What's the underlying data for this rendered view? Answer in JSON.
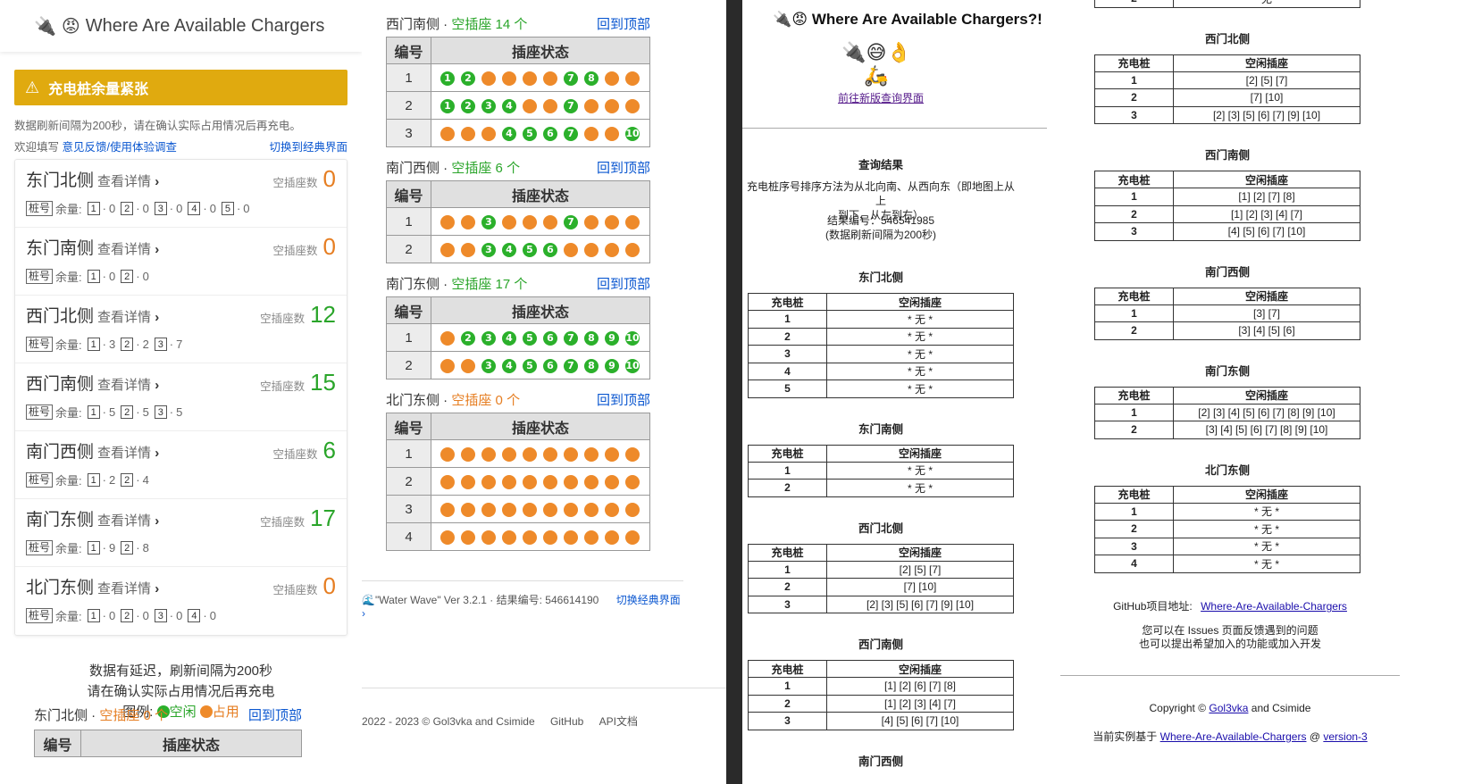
{
  "app": {
    "title": "Where Are Available Chargers",
    "warning": "充电桩余量紧张",
    "refresh_note": "数据刷新间隔为200秒，请在确认实际占用情况后再充电。",
    "welcome_prefix": "欢迎填写",
    "feedback_link": "意见反馈/使用体验调查",
    "switch_classic": "切换到经典界面",
    "detail_label": "查看详情",
    "free_label": "空插座数",
    "pile_tag": "桩号",
    "remain_label": "余量:",
    "footer_line1": "数据有延迟，刷新间隔为200秒",
    "footer_line2": "请在确认实际占用情况后再充电",
    "legend_label": "图例:",
    "legend_free": "空闲",
    "legend_busy": "占用",
    "back_top": "回到顶部",
    "header_no": "编号",
    "header_status": "插座状态",
    "free_prefix": "空插座",
    "free_suffix": "个",
    "version_text": "\"Water Wave\" Ver 3.2.1 · 结果编号: 546614190",
    "switch_classic2": "切换经典界面",
    "copyright2": "2022 - 2023 © Gol3vka and Csimide",
    "github": "GitHub",
    "api": "API文档"
  },
  "stations": [
    {
      "name": "东门北侧",
      "free": "0",
      "free_color": "orange",
      "piles": [
        [
          "1",
          "0"
        ],
        [
          "2",
          "0"
        ],
        [
          "3",
          "0"
        ],
        [
          "4",
          "0"
        ],
        [
          "5",
          "0"
        ]
      ]
    },
    {
      "name": "东门南侧",
      "free": "0",
      "free_color": "orange",
      "piles": [
        [
          "1",
          "0"
        ],
        [
          "2",
          "0"
        ]
      ]
    },
    {
      "name": "西门北侧",
      "free": "12",
      "free_color": "green",
      "piles": [
        [
          "1",
          "3"
        ],
        [
          "2",
          "2"
        ],
        [
          "3",
          "7"
        ]
      ]
    },
    {
      "name": "西门南侧",
      "free": "15",
      "free_color": "green",
      "piles": [
        [
          "1",
          "5"
        ],
        [
          "2",
          "5"
        ],
        [
          "3",
          "5"
        ]
      ]
    },
    {
      "name": "南门西侧",
      "free": "6",
      "free_color": "green",
      "piles": [
        [
          "1",
          "2"
        ],
        [
          "2",
          "4"
        ]
      ]
    },
    {
      "name": "南门东侧",
      "free": "17",
      "free_color": "green",
      "piles": [
        [
          "1",
          "9"
        ],
        [
          "2",
          "8"
        ]
      ]
    },
    {
      "name": "北门东侧",
      "free": "0",
      "free_color": "orange",
      "piles": [
        [
          "1",
          "0"
        ],
        [
          "2",
          "0"
        ],
        [
          "3",
          "0"
        ],
        [
          "4",
          "0"
        ]
      ]
    }
  ],
  "p1_section": {
    "name": "东门北侧",
    "free": "0"
  },
  "p2_sections": [
    {
      "name": "西门南侧",
      "free": "14",
      "free_color": "green",
      "rows": [
        [
          "1",
          "1,2,7,8"
        ],
        [
          "2",
          "1,2,3,4,7"
        ],
        [
          "3",
          "4,5,6,7,10"
        ]
      ]
    },
    {
      "name": "南门西侧",
      "free": "6",
      "free_color": "green",
      "rows": [
        [
          "1",
          "3,7"
        ],
        [
          "2",
          "3,4,5,6"
        ]
      ]
    },
    {
      "name": "南门东侧",
      "free": "17",
      "free_color": "green",
      "rows": [
        [
          "1",
          "2,3,4,5,6,7,8,9,10"
        ],
        [
          "2",
          "3,4,5,6,7,8,9,10"
        ]
      ]
    },
    {
      "name": "北门东侧",
      "free": "0",
      "free_color": "orange",
      "rows": [
        [
          "1",
          ""
        ],
        [
          "2",
          ""
        ],
        [
          "3",
          ""
        ],
        [
          "4",
          ""
        ]
      ]
    }
  ],
  "classic": {
    "title": "Where Are Available Chargers?!",
    "new_link": "前往新版查询界面",
    "query_title": "查询结果",
    "sort_note1": "充电桩序号排序方法为从北向南、从西向东（即地图上从上",
    "sort_note2": "到下、从左到右）",
    "result_no": "结果编号：546541985",
    "refresh": "(数据刷新间隔为200秒)",
    "col_pile": "充电桩",
    "col_free": "空闲插座",
    "github_label": "GitHub项目地址:",
    "github_link": "Where-Are-Available-Chargers",
    "issue1": "您可以在 Issues 页面反馈遇到的问题",
    "issue2": "也可以提出希望加入的功能或加入开发",
    "copy_prefix": "Copyright ©",
    "copy_author": "Gol3vka",
    "copy_suffix": "and Csimide",
    "based_prefix": "当前实例基于",
    "based_link": "Where-Are-Available-Chargers",
    "based_at": "@",
    "based_ver": "version-3",
    "none": "* 无 *",
    "left_tables": [
      {
        "name": "东门北侧",
        "rows": [
          [
            "1",
            "* 无 *"
          ],
          [
            "2",
            "* 无 *"
          ],
          [
            "3",
            "* 无 *"
          ],
          [
            "4",
            "* 无 *"
          ],
          [
            "5",
            "* 无 *"
          ]
        ]
      },
      {
        "name": "东门南侧",
        "rows": [
          [
            "1",
            "* 无 *"
          ],
          [
            "2",
            "* 无 *"
          ]
        ]
      },
      {
        "name": "西门北侧",
        "rows": [
          [
            "1",
            "[2] [5] [7]"
          ],
          [
            "2",
            "[7] [10]"
          ],
          [
            "3",
            "[2] [3] [5] [6] [7] [9] [10]"
          ]
        ]
      },
      {
        "name": "西门南侧",
        "rows": [
          [
            "1",
            "[1] [2] [6] [7] [8]"
          ],
          [
            "2",
            "[1] [2] [3] [4] [7]"
          ],
          [
            "3",
            "[4] [5] [6] [7] [10]"
          ]
        ]
      },
      {
        "name": "南门西侧",
        "rows": []
      }
    ],
    "right_tables": [
      {
        "name": "",
        "rows": [
          [
            "2",
            "* 无 *"
          ]
        ]
      },
      {
        "name": "西门北侧",
        "rows": [
          [
            "1",
            "[2] [5] [7]"
          ],
          [
            "2",
            "[7] [10]"
          ],
          [
            "3",
            "[2] [3] [5] [6] [7] [9] [10]"
          ]
        ]
      },
      {
        "name": "西门南侧",
        "rows": [
          [
            "1",
            "[1] [2] [7] [8]"
          ],
          [
            "2",
            "[1] [2] [3] [4] [7]"
          ],
          [
            "3",
            "[4] [5] [6] [7] [10]"
          ]
        ]
      },
      {
        "name": "南门西侧",
        "rows": [
          [
            "1",
            "[3] [7]"
          ],
          [
            "2",
            "[3] [4] [5] [6]"
          ]
        ]
      },
      {
        "name": "南门东侧",
        "rows": [
          [
            "1",
            "[2] [3] [4] [5] [6] [7] [8] [9] [10]"
          ],
          [
            "2",
            "[3] [4] [5] [6] [7] [8] [9] [10]"
          ]
        ]
      },
      {
        "name": "北门东侧",
        "rows": [
          [
            "1",
            "* 无 *"
          ],
          [
            "2",
            "* 无 *"
          ],
          [
            "3",
            "* 无 *"
          ],
          [
            "4",
            "* 无 *"
          ]
        ]
      }
    ]
  }
}
